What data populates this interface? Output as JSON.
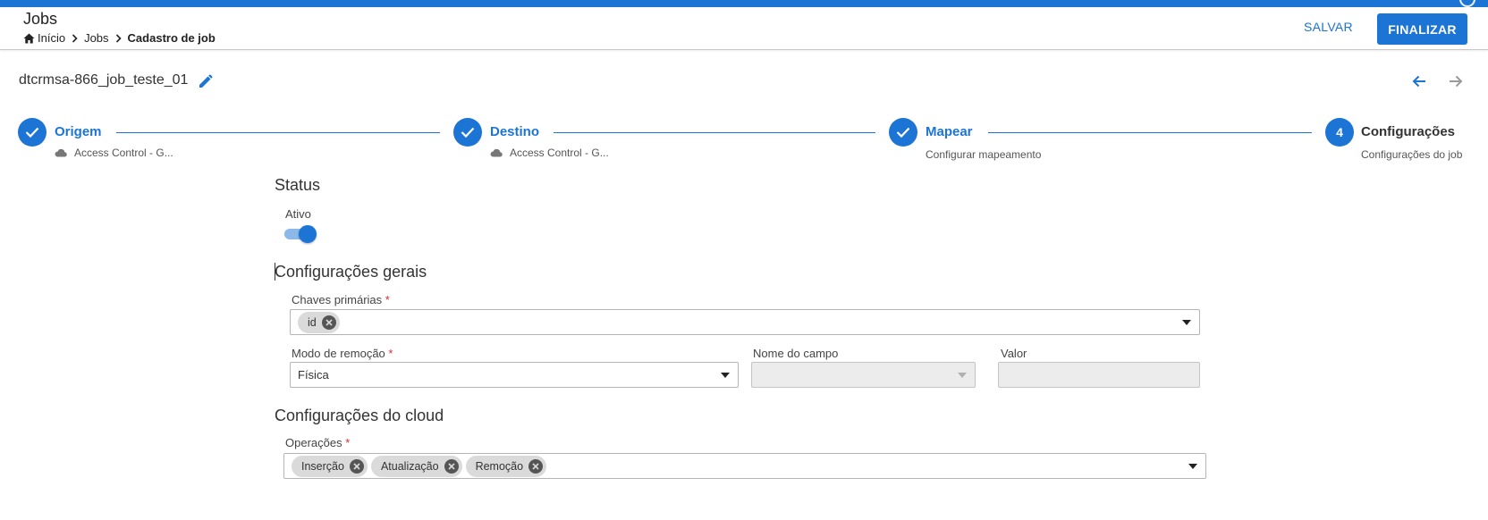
{
  "header": {
    "title": "Jobs",
    "breadcrumb": [
      {
        "label": "Início"
      },
      {
        "label": "Jobs"
      },
      {
        "label": "Cadastro de job"
      }
    ],
    "save_label": "SALVAR",
    "finish_label": "FINALIZAR"
  },
  "job": {
    "name": "dtcrmsa-866_job_teste_01"
  },
  "stepper": {
    "steps": [
      {
        "title": "Origem",
        "subtitle": "Access Control - G...",
        "state": "done",
        "icon": "check-icon"
      },
      {
        "title": "Destino",
        "subtitle": "Access Control - G...",
        "state": "done",
        "icon": "check-icon"
      },
      {
        "title": "Mapear",
        "subtitle": "Configurar mapeamento",
        "state": "done",
        "icon": "check-icon"
      },
      {
        "title": "Configurações",
        "subtitle": "Configurações do job",
        "state": "active",
        "number": "4"
      }
    ]
  },
  "status": {
    "section_title": "Status",
    "active_label": "Ativo",
    "active": true
  },
  "general": {
    "section_title": "Configurações gerais",
    "primary_keys_label": "Chaves primárias",
    "required_mark": "*",
    "primary_keys": [
      "id"
    ],
    "removal_mode_label": "Modo de remoção",
    "removal_mode_value": "Física",
    "field_name_label": "Nome do campo",
    "field_name_value": "",
    "value_label": "Valor",
    "value_value": ""
  },
  "cloud": {
    "section_title": "Configurações do cloud",
    "operations_label": "Operações",
    "required_mark": "*",
    "operations": [
      "Inserção",
      "Atualização",
      "Remoção"
    ]
  },
  "colors": {
    "accent": "#1c74d4",
    "required": "#d32f2f",
    "chip": "#dadada"
  }
}
